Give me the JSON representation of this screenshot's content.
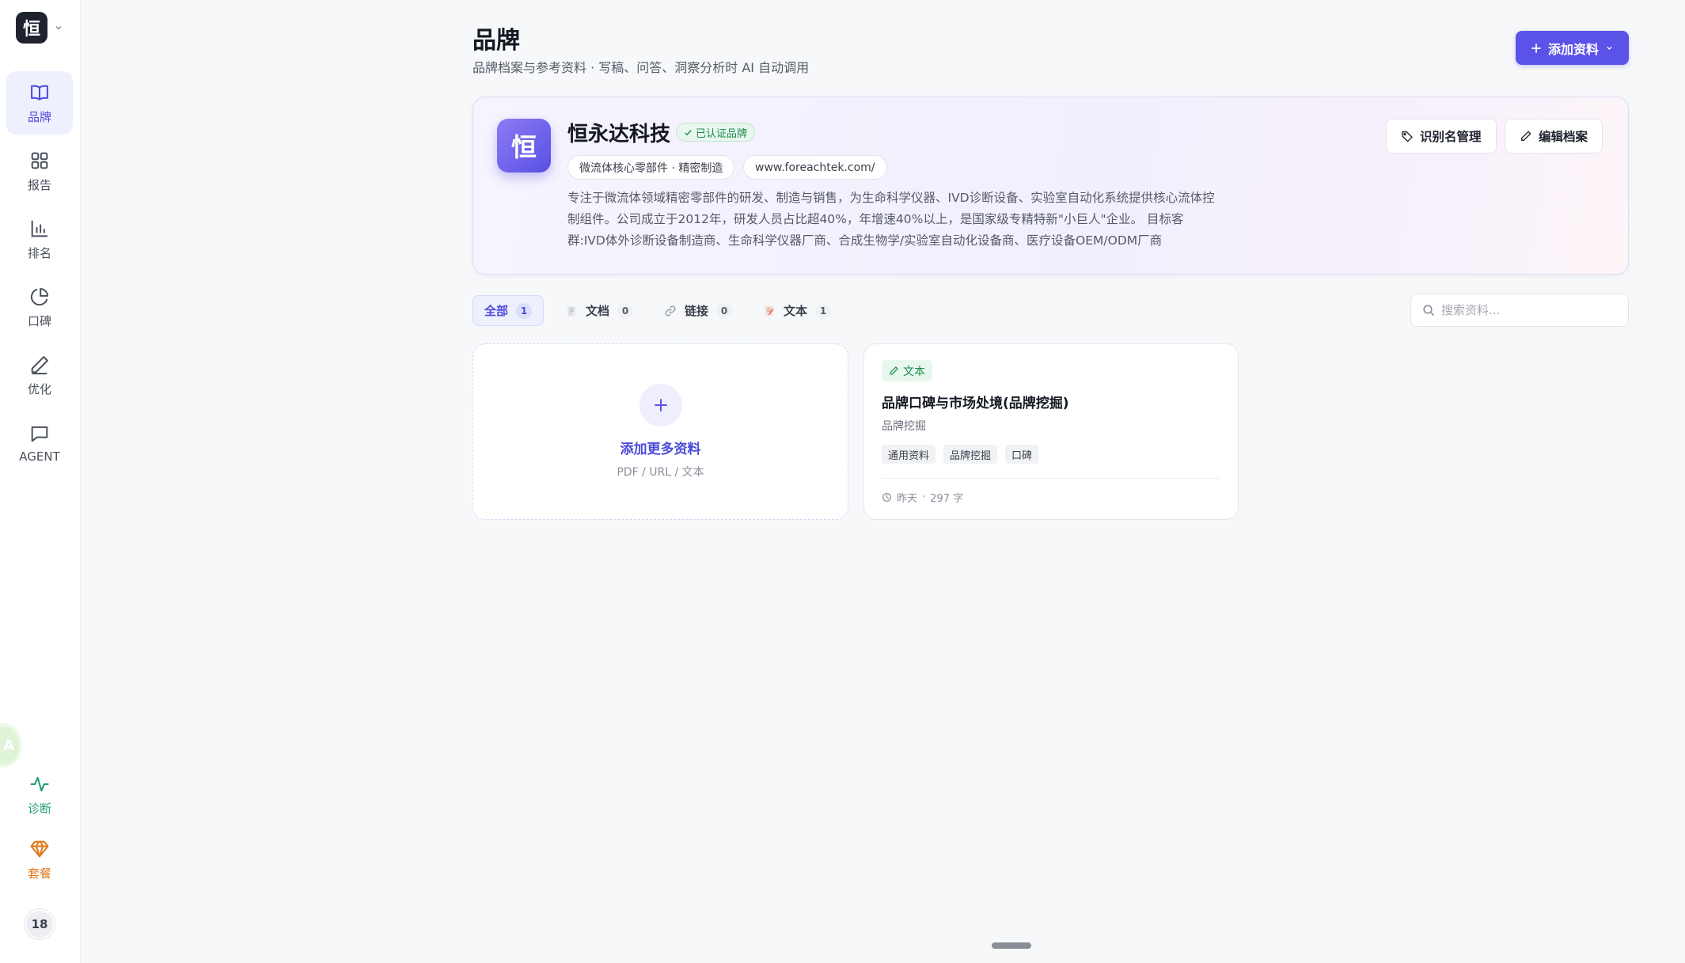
{
  "sidebar": {
    "logo_text": "恒",
    "items": [
      {
        "label": "品牌",
        "icon": "book-icon"
      },
      {
        "label": "报告",
        "icon": "grid-icon"
      },
      {
        "label": "排名",
        "icon": "bar-chart-icon"
      },
      {
        "label": "口碑",
        "icon": "pie-chart-icon"
      },
      {
        "label": "优化",
        "icon": "pen-icon"
      },
      {
        "label": "AGENT",
        "icon": "message-icon"
      }
    ],
    "bottom_items": [
      {
        "label": "诊断",
        "icon": "activity-icon",
        "color": "#1f9d7a"
      },
      {
        "label": "套餐",
        "icon": "diamond-icon",
        "color": "#e07a1f"
      }
    ],
    "bubble_text": "A",
    "count": "18"
  },
  "header": {
    "title": "品牌",
    "subtitle": "品牌档案与参考资料 · 写稿、问答、洞察分析时 AI 自动调用",
    "add_button": "添加资料"
  },
  "brand": {
    "logo_text": "恒",
    "name": "恒永达科技",
    "verified": "已认证品牌",
    "chips": [
      "微流体核心零部件 · 精密制造",
      "www.foreachtek.com/"
    ],
    "description_lines": [
      "专注于微流体领域精密零部件的研发、制造与销售，为生命科学仪器、IVD诊断设备、实验室自动化系统提供核心流体控",
      "制组件。公司成立于2012年，研发人员占比超40%，年增速40%以上，是国家级专精特新\"小巨人\"企业。 目标客",
      "群:IVD体外诊断设备制造商、生命科学仪器厂商、合成生物学/实验室自动化设备商、医疗设备OEM/ODM厂商"
    ],
    "alias_button": "识别名管理",
    "edit_button": "编辑档案"
  },
  "tabs": [
    {
      "label": "全部",
      "count": "1",
      "active": true
    },
    {
      "label": "文档",
      "count": "0",
      "active": false
    },
    {
      "label": "链接",
      "count": "0",
      "active": false
    },
    {
      "label": "文本",
      "count": "1",
      "active": false
    }
  ],
  "search": {
    "placeholder": "搜索资料..."
  },
  "add_card": {
    "title": "添加更多资料",
    "subtitle": "PDF / URL / 文本"
  },
  "doc_card": {
    "type": "文本",
    "title": "品牌口碑与市场处境(品牌挖掘)",
    "subtitle": "品牌挖掘",
    "tags": [
      "通用资料",
      "品牌挖掘",
      "口碑"
    ],
    "time": "昨天",
    "separator": "·",
    "length": "297 字"
  },
  "colors": {
    "accent": "#5b52e8",
    "green": "#1f8a4e",
    "orange": "#e07a1f"
  }
}
